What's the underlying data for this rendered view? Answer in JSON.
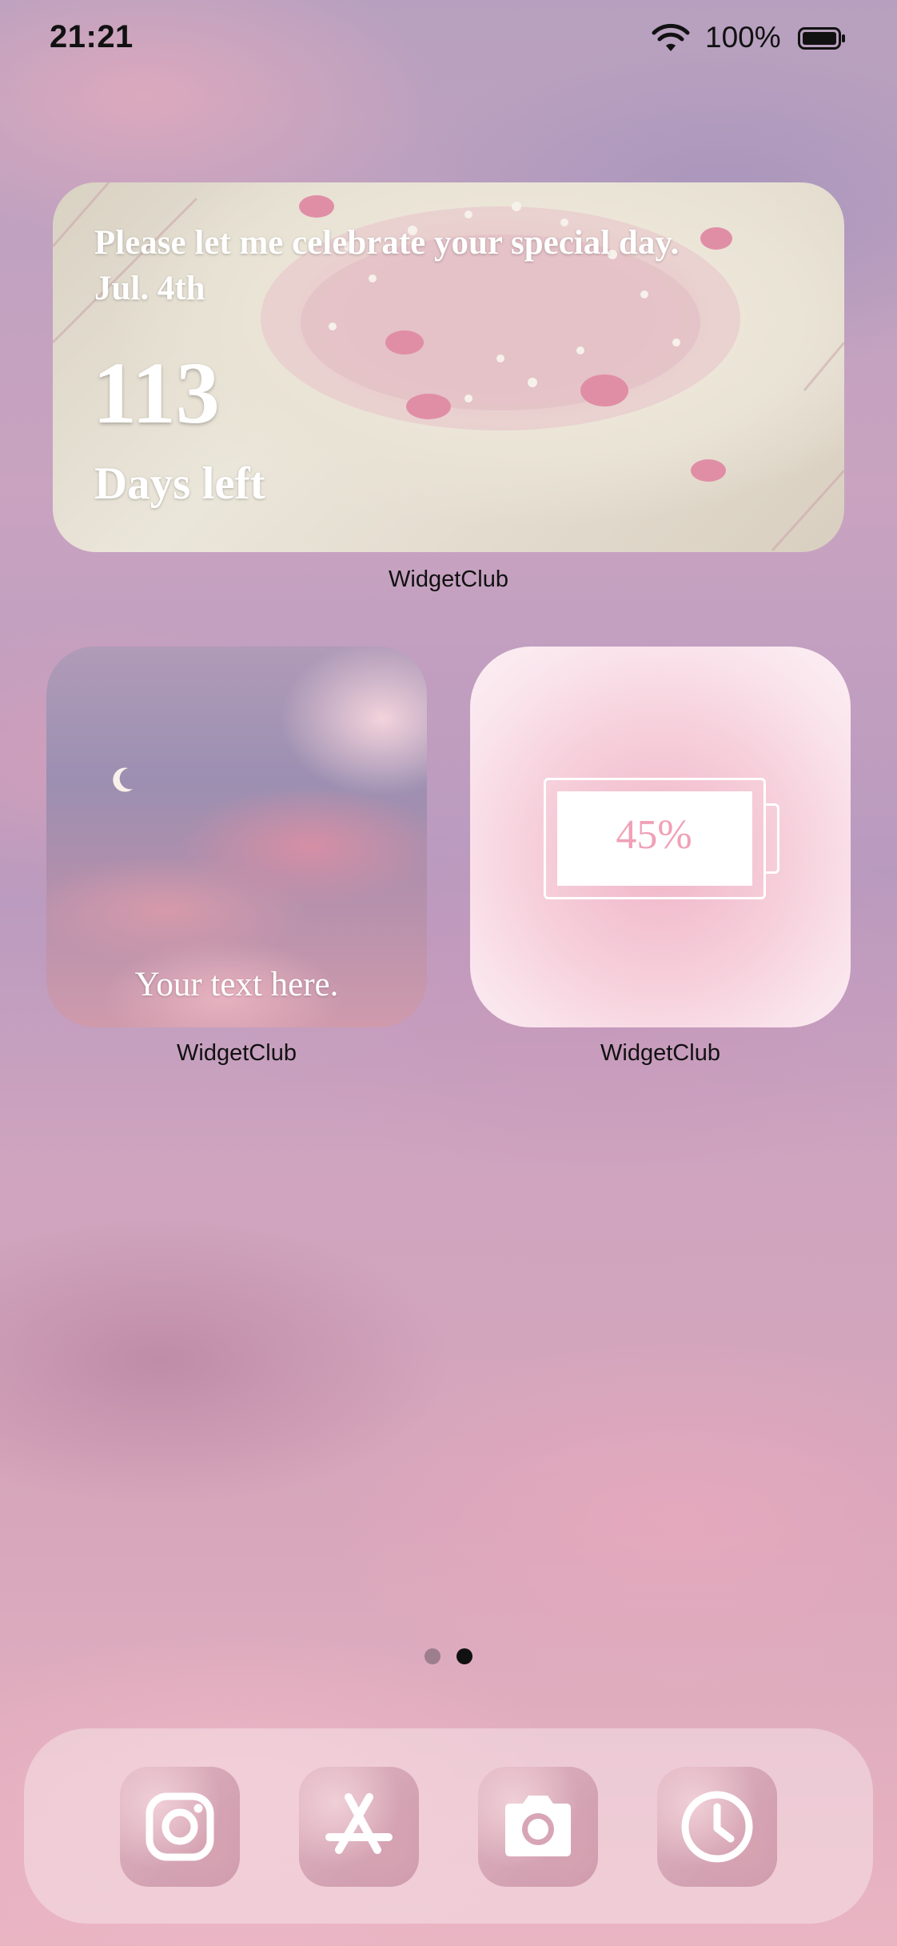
{
  "status_bar": {
    "time": "21:21",
    "battery_percent": "100%"
  },
  "widgets": {
    "countdown": {
      "title": "Please let me celebrate your special day.",
      "date": "Jul. 4th",
      "count": "113",
      "subtitle": "Days left",
      "label": "WidgetClub"
    },
    "photo": {
      "text": "Your text here.",
      "label": "WidgetClub"
    },
    "battery": {
      "percent_text": "45%",
      "level": 0.45,
      "label": "WidgetClub"
    }
  },
  "pager": {
    "pages": 2,
    "current": 2
  },
  "dock": {
    "apps": [
      {
        "icon": "instagram-icon"
      },
      {
        "icon": "app-store-icon"
      },
      {
        "icon": "camera-icon"
      },
      {
        "icon": "clock-icon"
      }
    ]
  },
  "colors": {
    "battery_text": "#f0a1b7",
    "widget_text": "#ffffff"
  }
}
